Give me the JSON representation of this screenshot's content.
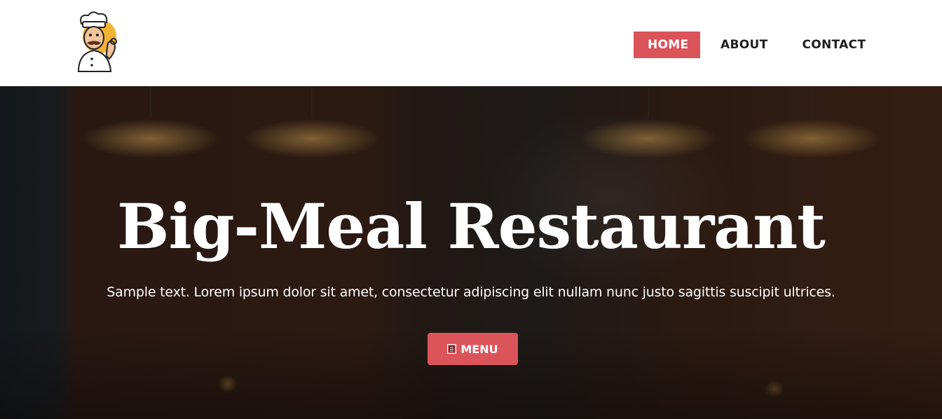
{
  "header": {
    "logo_icon": "chef-mascot-icon",
    "nav": [
      {
        "label": "HOME",
        "active": true
      },
      {
        "label": "ABOUT",
        "active": false
      },
      {
        "label": "CONTACT",
        "active": false
      }
    ]
  },
  "hero": {
    "title": "Big-Meal Restaurant",
    "text": "Sample text. Lorem ipsum dolor sit amet, consectetur adipiscing elit nullam nunc justo sagittis suscipit ultrices.",
    "button": {
      "label": "MENU",
      "icon": "menu-book-icon"
    }
  },
  "colors": {
    "accent": "#db545a",
    "nav_text": "#1f1f1f",
    "hero_text": "#ffffff"
  }
}
